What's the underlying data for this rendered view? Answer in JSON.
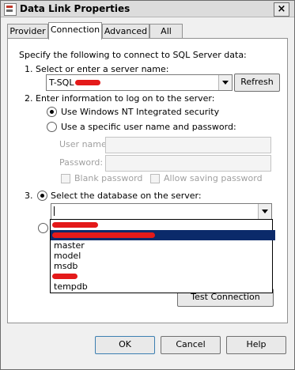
{
  "window": {
    "title": "Data Link Properties"
  },
  "tabs": [
    "Provider",
    "Connection",
    "Advanced",
    "All"
  ],
  "connection": {
    "intro": "Specify the following to connect to SQL Server data:",
    "step1_label": "1. Select or enter a server name:",
    "server_value": "T-SQL",
    "refresh_label": "Refresh",
    "step2_label": "2. Enter information to log on to the server:",
    "auth_windows": "Use Windows NT Integrated security",
    "auth_specific": "Use a specific user name and password:",
    "user_name_label": "User name:",
    "password_label": "Password:",
    "blank_password": "Blank password",
    "allow_saving": "Allow saving password",
    "step3_number": "3.",
    "step3_label": "Select the database on the server:",
    "database_value": "",
    "database_options": [
      "",
      "",
      "master",
      "model",
      "msdb",
      "",
      "tempdb"
    ],
    "selected_index": 1,
    "test_connection": "Test Connection"
  },
  "footer": {
    "ok": "OK",
    "cancel": "Cancel",
    "help": "Help"
  }
}
